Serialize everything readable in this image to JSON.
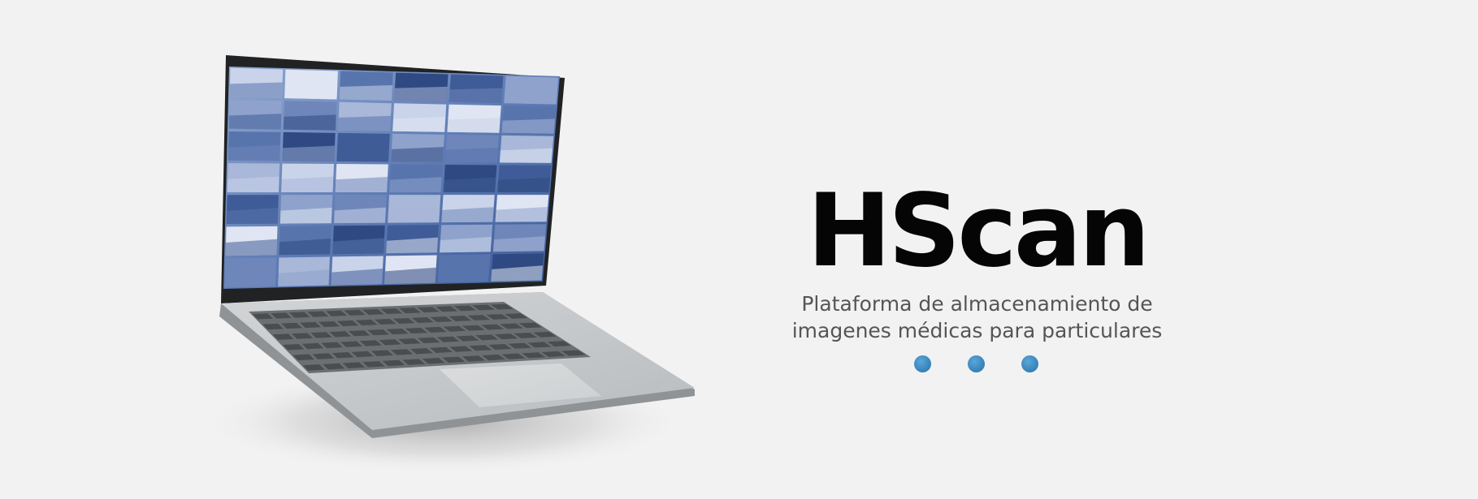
{
  "hero": {
    "title": "HScan",
    "subtitle_line1": "Plataforma de almacenamiento de",
    "subtitle_line2": "imagenes médicas para particulares"
  },
  "illustration": {
    "laptop_icon": "laptop-icon",
    "screen_content": "camera-grid-thumbnails"
  },
  "carousel": {
    "slide_count": 3,
    "dot_color": "#3a86bd"
  },
  "colors": {
    "background": "#f2f2f2",
    "title": "#050505",
    "subtitle": "#555555",
    "accent": "#3a86bd"
  }
}
